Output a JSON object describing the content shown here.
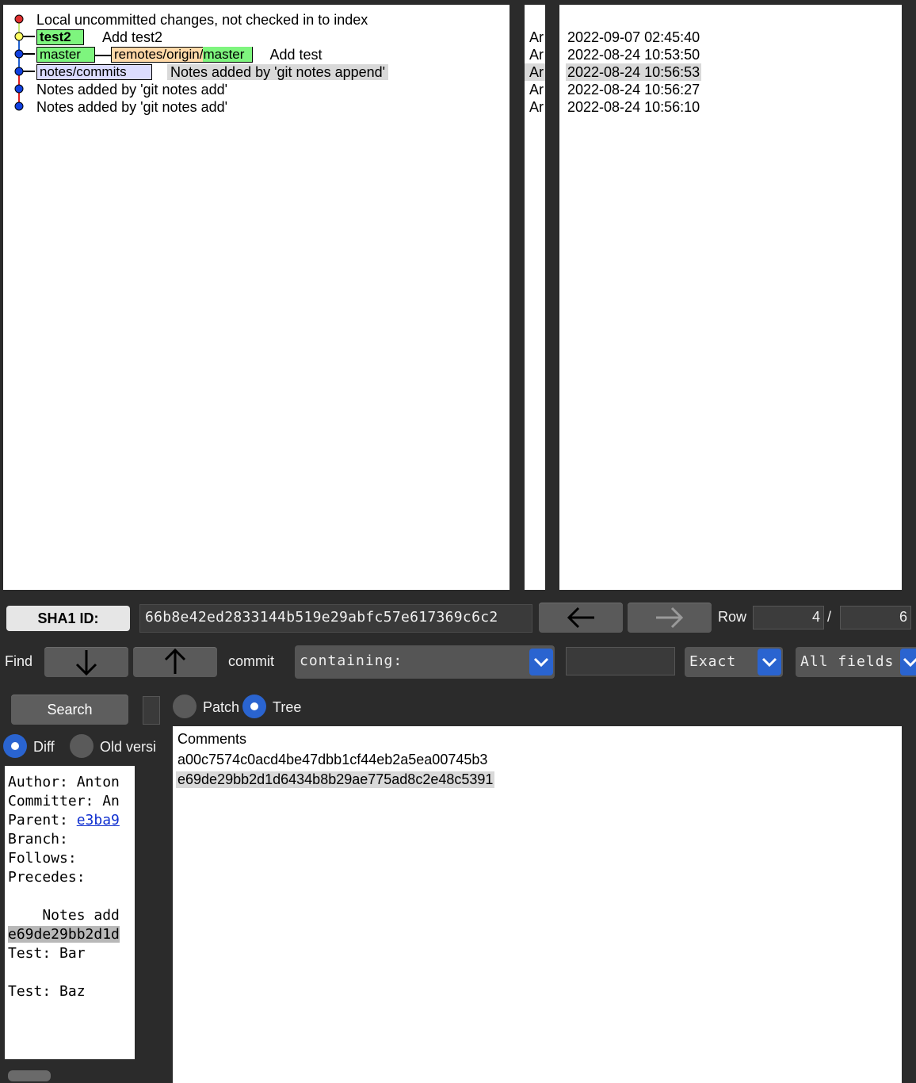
{
  "commit_list": {
    "rows": [
      {
        "text": "Local uncommitted changes, not checked in to index",
        "tags": []
      },
      {
        "text": "Add test2",
        "tags": [
          "test2"
        ]
      },
      {
        "text": "Add test",
        "tags": [
          "master",
          "remotes/origin/master"
        ]
      },
      {
        "text": "Notes added by 'git notes append'",
        "tags": [
          "notes/commits"
        ]
      },
      {
        "text": "Notes added by 'git notes add'",
        "tags": []
      },
      {
        "text": "Notes added by 'git notes add'",
        "tags": []
      }
    ],
    "remote_parts": [
      "remotes/",
      "origin/",
      "master"
    ]
  },
  "author_column": [
    "Ar",
    "Ar",
    "Ar",
    "Ar",
    "Ar"
  ],
  "date_column": [
    "2022-09-07 02:45:40",
    "2022-08-24 10:53:50",
    "2022-08-24 10:56:53",
    "2022-08-24 10:56:27",
    "2022-08-24 10:56:10"
  ],
  "toolbar": {
    "sha1_label": "SHA1 ID:",
    "sha1_value": "66b8e42ed2833144b519e29abfc57e617369c6c2",
    "row_label": "Row",
    "row_current": "4",
    "row_separator": "/",
    "row_total": "6"
  },
  "find_bar": {
    "find_label": "Find",
    "commit_label": "commit",
    "mode": "containing:",
    "match": "Exact",
    "fields": "All fields"
  },
  "search": {
    "search_label": "Search",
    "patch_label": "Patch",
    "tree_label": "Tree",
    "diff_label": "Diff",
    "old_version_label": "Old versi"
  },
  "details": {
    "author": "Author: Anton",
    "committer": "Committer: An",
    "parent_label": "Parent: ",
    "parent_link": "e3ba9",
    "branch": "Branch:",
    "follows": "Follows:",
    "precedes": "Precedes:",
    "notes_head": "    Notes add",
    "notes_sha": "e69de29bb2d1d",
    "test_bar": "Test: Bar",
    "test_baz": "Test: Baz"
  },
  "tree_pane": {
    "header": "Comments",
    "files": [
      "a00c7574c0acd4be47dbb1cf44eb2a5ea00745b3",
      "e69de29bb2d1d6434b8b29ae775ad8c2e48c5391"
    ]
  },
  "colors": {
    "local_tag": "#7ef57e",
    "remote_tag": "#ffd9a8",
    "notes_tag": "#dcdcff",
    "accent": "#2a64d0"
  }
}
